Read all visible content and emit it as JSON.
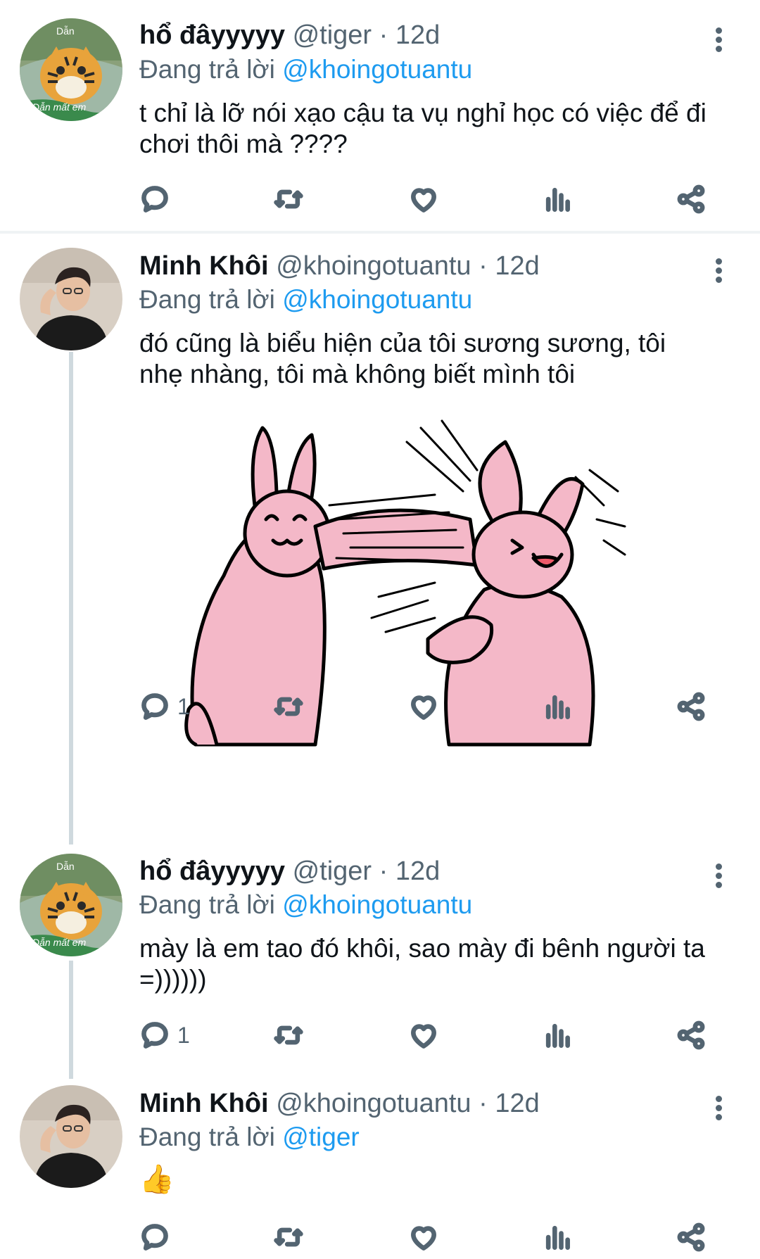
{
  "tweets": [
    {
      "name": "hổ đâyyyyy",
      "handle": "@tiger",
      "sep": "·",
      "time": "12d",
      "replying_prefix": "Đang trả lời",
      "replying_to": "@khoingotuantu",
      "text": "t chỉ là lỡ nói xạo cậu ta vụ nghỉ học có việc để đi chơi thôi mà ????",
      "reply_count": "",
      "avatar": "tiger-avatar",
      "avatar_caption_top": "Dẫn",
      "avatar_caption_bottom": "Dẫn mất em"
    },
    {
      "name": "Minh Khôi",
      "handle": "@khoingotuantu",
      "sep": "·",
      "time": "12d",
      "replying_prefix": "Đang trả lời",
      "replying_to": "@khoingotuantu",
      "text": "đó cũng là biểu hiện của tôi sương sương, tôi nhẹ nhàng, tôi mà không biết mình tôi",
      "reply_count": "1",
      "avatar": "man-avatar"
    },
    {
      "name": "hổ đâyyyyy",
      "handle": "@tiger",
      "sep": "·",
      "time": "12d",
      "replying_prefix": "Đang trả lời",
      "replying_to": "@khoingotuantu",
      "text": "mày là em tao đó khôi, sao mày đi bênh người ta =))))))",
      "reply_count": "1",
      "avatar": "tiger-avatar",
      "avatar_caption_top": "Dẫn",
      "avatar_caption_bottom": "Dẫn mất em"
    },
    {
      "name": "Minh Khôi",
      "handle": "@khoingotuantu",
      "sep": "·",
      "time": "12d",
      "replying_prefix": "Đang trả lời",
      "replying_to": "@tiger",
      "text": "👍",
      "reply_count": "",
      "avatar": "man-avatar"
    }
  ],
  "colors": {
    "accent": "#1d9bf0",
    "muted": "#536471",
    "text": "#0f1419",
    "bunny": "#f4b8c8",
    "divider": "#eff3f4"
  }
}
